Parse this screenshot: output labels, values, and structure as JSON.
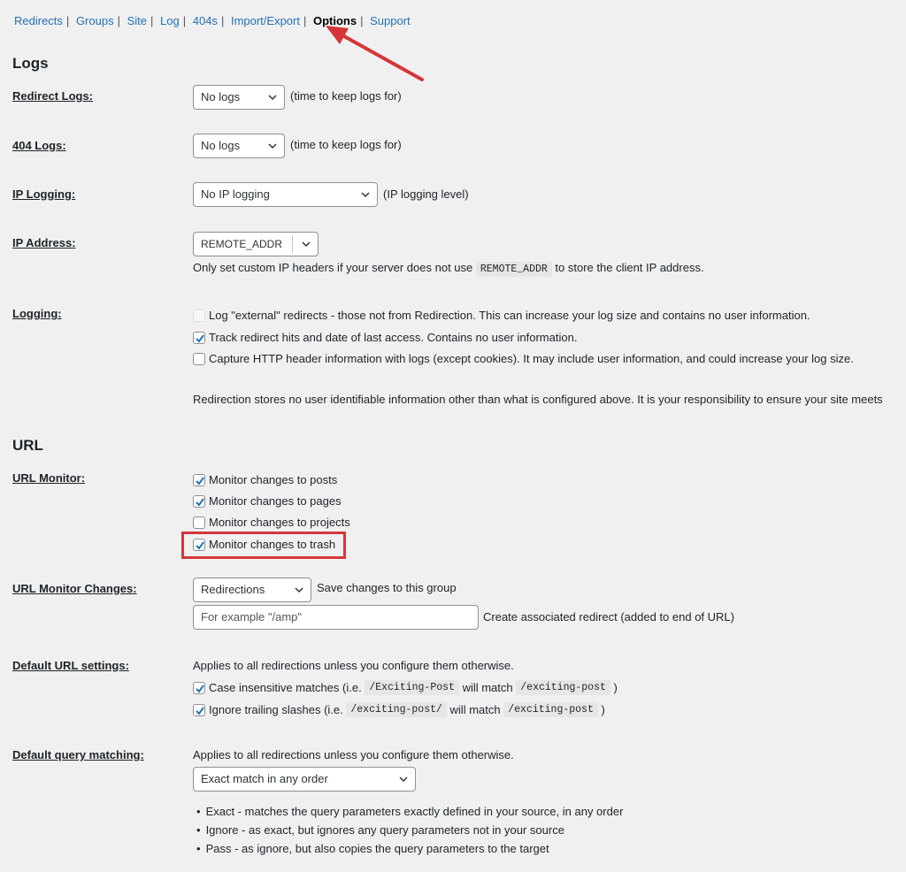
{
  "nav": [
    {
      "label": "Redirects",
      "current": false
    },
    {
      "label": "Groups",
      "current": false
    },
    {
      "label": "Site",
      "current": false
    },
    {
      "label": "Log",
      "current": false
    },
    {
      "label": "404s",
      "current": false
    },
    {
      "label": "Import/Export",
      "current": false
    },
    {
      "label": "Options",
      "current": true
    },
    {
      "label": "Support",
      "current": false
    }
  ],
  "nav_separator": "|",
  "logs": {
    "heading": "Logs",
    "redirect_logs": {
      "label": "Redirect Logs:",
      "value": "No logs",
      "hint": "(time to keep logs for)"
    },
    "logs_404": {
      "label": "404 Logs:",
      "value": "No logs",
      "hint": "(time to keep logs for)"
    },
    "ip_logging": {
      "label": "IP Logging:",
      "value": "No IP logging",
      "hint": "(IP logging level)"
    },
    "ip_address": {
      "label": "IP Address:",
      "value": "REMOTE_ADDR",
      "help_before": "Only set custom IP headers if your server does not use",
      "help_code": "REMOTE_ADDR",
      "help_after": "to store the client IP address."
    },
    "logging": {
      "label": "Logging:",
      "options": [
        {
          "label": "Log \"external\" redirects - those not from Redirection. This can increase your log size and contains no user information.",
          "checked": false
        },
        {
          "label": "Track redirect hits and date of last access. Contains no user information.",
          "checked": true
        },
        {
          "label": "Capture HTTP header information with logs (except cookies). It may include user information, and could increase your log size.",
          "checked": false
        }
      ],
      "notice": "Redirection stores no user identifiable information other than what is configured above. It is your responsibility to ensure your site meets"
    }
  },
  "url": {
    "heading": "URL",
    "monitor": {
      "label": "URL Monitor:",
      "options": [
        {
          "label": "Monitor changes to posts",
          "checked": true
        },
        {
          "label": "Monitor changes to pages",
          "checked": true
        },
        {
          "label": "Monitor changes to projects",
          "checked": false
        },
        {
          "label": "Monitor changes to trash",
          "checked": true
        }
      ]
    },
    "monitor_changes": {
      "label": "URL Monitor Changes:",
      "group_value": "Redirections",
      "group_hint": "Save changes to this group",
      "input_placeholder": "For example \"/amp\"",
      "input_hint": "Create associated redirect (added to end of URL)"
    },
    "default_settings": {
      "label": "Default URL settings:",
      "intro": "Applies to all redirections unless you configure them otherwise.",
      "case": {
        "checked": true,
        "t1": "Case insensitive matches (i.e.",
        "c1": "/Exciting-Post",
        "t2": "will match",
        "c2": "/exciting-post",
        "t3": ")"
      },
      "slash": {
        "checked": true,
        "t1": "Ignore trailing slashes (i.e.",
        "c1": "/exciting-post/",
        "t2": "will match",
        "c2": "/exciting-post",
        "t3": ")"
      }
    },
    "query": {
      "label": "Default query matching:",
      "intro": "Applies to all redirections unless you configure them otherwise.",
      "value": "Exact match in any order",
      "bullets": [
        "Exact - matches the query parameters exactly defined in your source, in any order",
        "Ignore - as exact, but ignores any query parameters not in your source",
        "Pass - as ignore, but also copies the query parameters to the target"
      ]
    }
  },
  "colors": {
    "link": "#2271b1",
    "annotation": "#d63638",
    "background": "#f0f0f1"
  }
}
